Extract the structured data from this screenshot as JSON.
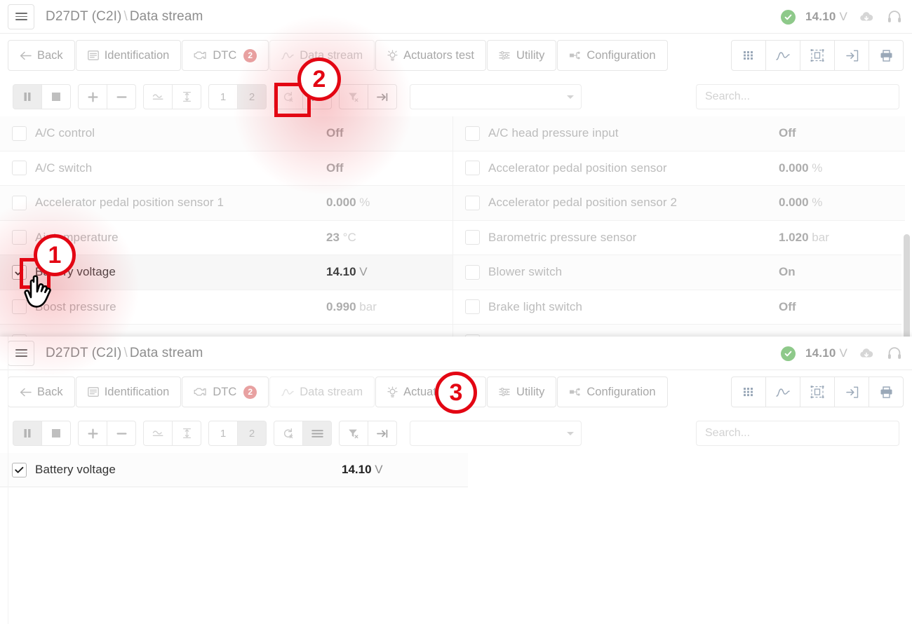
{
  "app": {
    "titlebar": {
      "menu_icon": "hamburger-menu-icon",
      "breadcrumb_root": "D27DT (C2I)",
      "breadcrumb_sep": "\\",
      "breadcrumb_leaf": "Data stream",
      "status_icon": "check-circle-icon",
      "voltage_value": "14.10",
      "voltage_unit": "V",
      "cloud_icon": "cloud-download-icon",
      "support_icon": "headset-icon"
    },
    "tabs": [
      {
        "label": "Back",
        "icon": "arrow-left-icon",
        "state": "normal"
      },
      {
        "label": "Identification",
        "icon": "list-card-icon",
        "state": "normal"
      },
      {
        "label": "DTC",
        "icon": "engine-icon",
        "state": "normal",
        "badge": "2"
      },
      {
        "label": "Data stream",
        "icon": "chart-line-icon",
        "state": "active-muted"
      },
      {
        "label": "Actuators test",
        "icon": "bulb-icon",
        "state": "normal"
      },
      {
        "label": "Utility",
        "icon": "sliders-icon",
        "state": "normal"
      },
      {
        "label": "Configuration",
        "icon": "hierarchy-icon",
        "state": "normal"
      }
    ],
    "tabbar_right_buttons": [
      {
        "icon": "grid-view-icon"
      },
      {
        "icon": "graph-view-icon"
      },
      {
        "icon": "fullscreen-icon"
      },
      {
        "icon": "export-icon"
      },
      {
        "icon": "print-icon"
      }
    ],
    "toolbar": {
      "buttons": [
        {
          "icon": "pause-icon",
          "label": "",
          "state": "on"
        },
        {
          "icon": "stop-icon",
          "label": "",
          "state": "normal"
        },
        {
          "icon": "plus-icon",
          "label": "",
          "state": "normal"
        },
        {
          "icon": "minus-icon",
          "label": "",
          "state": "normal"
        },
        {
          "icon": "approx-wave-icon",
          "label": "",
          "state": "normal"
        },
        {
          "icon": "vertical-fit-icon",
          "label": "",
          "state": "normal"
        },
        {
          "icon": "page-1-icon",
          "label": "1",
          "state": "normal"
        },
        {
          "icon": "page-2-icon",
          "label": "2",
          "state": "on"
        },
        {
          "icon": "reset-chart-icon",
          "label": "",
          "state": "faint"
        },
        {
          "icon": "list-view-icon",
          "label": "",
          "state": "normal"
        },
        {
          "icon": "clear-filter-icon",
          "label": "",
          "state": "faint"
        },
        {
          "icon": "jump-end-icon",
          "label": "",
          "state": "normal"
        }
      ],
      "dropdown_value": "",
      "search_placeholder": "Search..."
    },
    "toolbar_bottom": {
      "buttons": [
        {
          "icon": "pause-icon",
          "label": "",
          "state": "on"
        },
        {
          "icon": "stop-icon",
          "label": "",
          "state": "normal"
        },
        {
          "icon": "plus-icon",
          "label": "",
          "state": "normal"
        },
        {
          "icon": "minus-icon",
          "label": "",
          "state": "normal"
        },
        {
          "icon": "approx-wave-icon",
          "label": "",
          "state": "normal"
        },
        {
          "icon": "vertical-fit-icon",
          "label": "",
          "state": "normal"
        },
        {
          "icon": "page-1-icon",
          "label": "1",
          "state": "normal"
        },
        {
          "icon": "page-2-icon",
          "label": "2",
          "state": "on"
        },
        {
          "icon": "reset-chart-icon",
          "label": "",
          "state": "normal"
        },
        {
          "icon": "hamburger-list-icon",
          "label": "",
          "state": "on"
        },
        {
          "icon": "clear-filter-icon",
          "label": "",
          "state": "normal"
        },
        {
          "icon": "jump-end-icon",
          "label": "",
          "state": "normal"
        }
      ],
      "dropdown_value": "",
      "search_placeholder": "Search..."
    }
  },
  "grid_top": {
    "left_column": [
      {
        "name": "A/C control",
        "value": "Off",
        "unit": "",
        "checked": false
      },
      {
        "name": "A/C switch",
        "value": "Off",
        "unit": "",
        "checked": false
      },
      {
        "name": "Accelerator pedal position sensor 1",
        "value": "0.000",
        "unit": "%",
        "checked": false
      },
      {
        "name": "Air temperature",
        "value": "23",
        "unit": "°C",
        "checked": false
      },
      {
        "name": "Battery voltage",
        "value": "14.10",
        "unit": "V",
        "checked": true
      },
      {
        "name": "Boost pressure",
        "value": "0.990",
        "unit": "bar",
        "checked": false
      }
    ],
    "right_column": [
      {
        "name": "A/C head pressure input",
        "value": "Off",
        "unit": "",
        "checked": false
      },
      {
        "name": "Accelerator pedal position sensor",
        "value": "0.000",
        "unit": "%",
        "checked": false
      },
      {
        "name": "Accelerator pedal position sensor 2",
        "value": "0.000",
        "unit": "%",
        "checked": false
      },
      {
        "name": "Barometric pressure sensor",
        "value": "1.020",
        "unit": "bar",
        "checked": false
      },
      {
        "name": "Blower switch",
        "value": "On",
        "unit": "",
        "checked": false
      },
      {
        "name": "Brake light switch",
        "value": "Off",
        "unit": "",
        "checked": false
      }
    ]
  },
  "grid_bottom": {
    "rows": [
      {
        "name": "Battery voltage",
        "value": "14.10",
        "unit": "V",
        "checked": true
      }
    ]
  },
  "annotations": [
    {
      "number": "1",
      "target": "battery-voltage-checkbox"
    },
    {
      "number": "2",
      "target": "list-view-toolbar-button"
    },
    {
      "number": "3",
      "target": "bottom-panel-result"
    }
  ],
  "colors": {
    "annotation_red": "#e30613",
    "status_green": "#8ec98a",
    "badge_red": "#e8a1a1"
  }
}
